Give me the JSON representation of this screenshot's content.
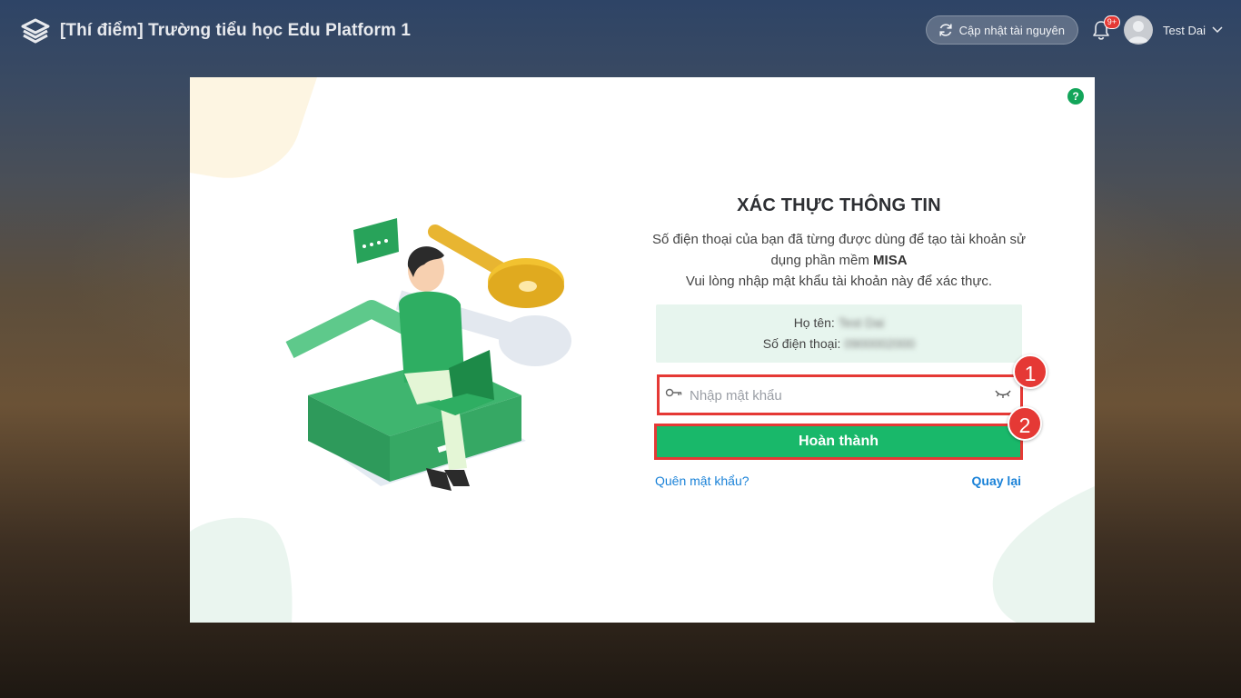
{
  "header": {
    "title": "[Thí điểm] Trường tiểu học Edu Platform 1",
    "update_label": "Cập nhật tài nguyên",
    "notification_badge": "9+",
    "user_name": "Test Dai",
    "icons": [
      "logo-icon",
      "refresh-icon",
      "bell-icon",
      "avatar",
      "chevron-down-icon"
    ]
  },
  "modal": {
    "help": "?",
    "title": "XÁC THỰC THÔNG TIN",
    "description_line1": "Số điện thoại của bạn đã từng được dùng để tạo tài khoản sử dụng phần mềm",
    "description_brand": "MISA",
    "description_line2": "Vui lòng nhập mật khẩu tài khoản này để xác thực.",
    "info": {
      "name_label": "Họ tên:",
      "name_value": "Test Dai",
      "phone_label": "Số điện thoại:",
      "phone_value": "0900002000"
    },
    "password": {
      "placeholder": "Nhập mật khẩu",
      "value": ""
    },
    "submit_label": "Hoàn thành",
    "forgot_label": "Quên mật khẩu?",
    "back_label": "Quay lại",
    "markers": [
      "1",
      "2"
    ]
  },
  "colors": {
    "primary": "#19b86a",
    "help": "#13a55a",
    "link": "#1a82d8",
    "highlight": "#e53935",
    "info_bg": "#e7f5ee"
  }
}
